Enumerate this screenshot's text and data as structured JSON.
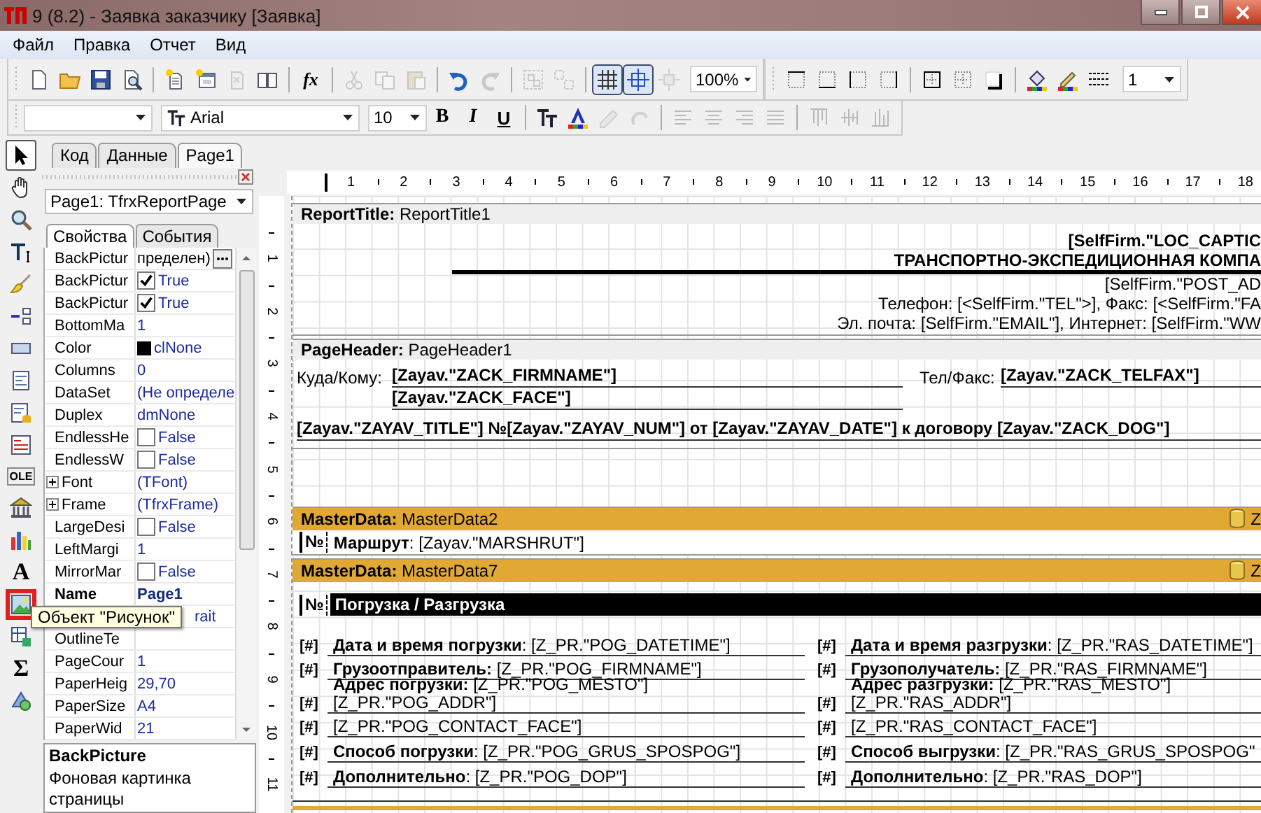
{
  "window": {
    "title": "9 (8.2) - Заявка заказчику [Заявка]"
  },
  "menu": [
    "Файл",
    "Правка",
    "Отчет",
    "Вид"
  ],
  "toolbar_main": [
    {
      "kind": "icon",
      "disabled": false,
      "pressed": false
    },
    {
      "kind": "icon",
      "disabled": false,
      "pressed": false
    },
    {
      "kind": "icon",
      "disabled": false,
      "pressed": false
    },
    {
      "kind": "icon",
      "disabled": false,
      "pressed": false
    },
    {
      "kind": "separator"
    },
    {
      "kind": "icon",
      "disabled": false,
      "pressed": false
    },
    {
      "kind": "icon",
      "disabled": false,
      "pressed": false
    },
    {
      "kind": "icon",
      "disabled": true,
      "pressed": false
    },
    {
      "kind": "icon",
      "disabled": false,
      "pressed": false
    },
    {
      "kind": "separator"
    },
    {
      "kind": "formula",
      "label": "fx",
      "disabled": false,
      "pressed": false
    },
    {
      "kind": "separator"
    },
    {
      "kind": "icon",
      "disabled": true,
      "pressed": false
    },
    {
      "kind": "icon",
      "disabled": true,
      "pressed": false
    },
    {
      "kind": "icon",
      "disabled": true,
      "pressed": false
    },
    {
      "kind": "separator"
    },
    {
      "kind": "icon",
      "disabled": false,
      "pressed": false
    },
    {
      "kind": "icon",
      "disabled": true,
      "pressed": false
    },
    {
      "kind": "separator"
    },
    {
      "kind": "icon",
      "disabled": true,
      "pressed": false
    },
    {
      "kind": "icon",
      "disabled": true,
      "pressed": false
    },
    {
      "kind": "separator"
    },
    {
      "kind": "icon",
      "disabled": false,
      "pressed": true
    },
    {
      "kind": "icon",
      "disabled": false,
      "pressed": true
    },
    {
      "kind": "icon",
      "disabled": true,
      "pressed": false
    },
    {
      "kind": "combo",
      "value": "100%"
    },
    {
      "kind": "break"
    },
    {
      "kind": "icon",
      "disabled": false,
      "pressed": false
    },
    {
      "kind": "icon",
      "disabled": false,
      "pressed": false
    },
    {
      "kind": "icon",
      "disabled": false,
      "pressed": false
    },
    {
      "kind": "icon",
      "disabled": false,
      "pressed": false
    },
    {
      "kind": "separator"
    },
    {
      "kind": "icon",
      "disabled": false,
      "pressed": false
    },
    {
      "kind": "icon",
      "disabled": false,
      "pressed": false
    },
    {
      "kind": "icon",
      "disabled": false,
      "pressed": false
    },
    {
      "kind": "separator"
    },
    {
      "kind": "icon",
      "disabled": false,
      "pressed": false
    },
    {
      "kind": "icon",
      "disabled": false,
      "pressed": false
    },
    {
      "kind": "icon",
      "disabled": false,
      "pressed": false
    },
    {
      "kind": "combo",
      "value": "1"
    }
  ],
  "toolbar_format": [
    {
      "kind": "combo"
    },
    {
      "kind": "font_combo",
      "value": "Arial"
    },
    {
      "kind": "combo",
      "value": "10"
    },
    {
      "kind": "bold",
      "label": "B",
      "disabled": false,
      "pressed": false
    },
    {
      "kind": "italic",
      "label": "I",
      "disabled": false,
      "pressed": false
    },
    {
      "kind": "underline",
      "label": "U",
      "disabled": false,
      "pressed": false
    },
    {
      "kind": "separator"
    },
    {
      "kind": "icon",
      "disabled": false,
      "pressed": false
    },
    {
      "kind": "icon",
      "disabled": false,
      "pressed": false
    },
    {
      "kind": "icon",
      "disabled": true,
      "pressed": false
    },
    {
      "kind": "icon",
      "disabled": true,
      "pressed": false
    },
    {
      "kind": "separator"
    },
    {
      "kind": "icon",
      "disabled": true,
      "pressed": false
    },
    {
      "kind": "icon",
      "disabled": true,
      "pressed": false
    },
    {
      "kind": "icon",
      "disabled": true,
      "pressed": false
    },
    {
      "kind": "icon",
      "disabled": true,
      "pressed": false
    },
    {
      "kind": "separator"
    },
    {
      "kind": "icon",
      "disabled": true,
      "pressed": false
    },
    {
      "kind": "icon",
      "disabled": true,
      "pressed": false
    },
    {
      "kind": "icon",
      "disabled": true,
      "pressed": false
    }
  ],
  "tools": [
    {
      "kind": "icon",
      "selected": true,
      "highlighted": false
    },
    {
      "kind": "icon",
      "selected": false,
      "highlighted": false
    },
    {
      "kind": "icon",
      "selected": false,
      "highlighted": false
    },
    {
      "kind": "icon",
      "selected": false,
      "highlighted": false
    },
    {
      "kind": "icon",
      "selected": false,
      "highlighted": false
    },
    {
      "kind": "icon",
      "selected": false,
      "highlighted": false
    },
    {
      "kind": "icon",
      "selected": false,
      "highlighted": false
    },
    {
      "kind": "icon",
      "selected": false,
      "highlighted": false
    },
    {
      "kind": "icon",
      "selected": false,
      "highlighted": false
    },
    {
      "kind": "icon",
      "selected": false,
      "highlighted": false
    },
    {
      "kind": "label",
      "label": "OLE",
      "selected": false,
      "highlighted": false
    },
    {
      "kind": "icon",
      "selected": false,
      "highlighted": false
    },
    {
      "kind": "icon",
      "selected": false,
      "highlighted": false
    },
    {
      "kind": "glyph",
      "label": "A",
      "selected": false,
      "highlighted": false
    },
    {
      "kind": "icon",
      "selected": false,
      "highlighted": true
    },
    {
      "kind": "icon",
      "selected": false,
      "highlighted": false
    },
    {
      "kind": "glyph",
      "label": "Σ",
      "selected": false,
      "highlighted": false
    },
    {
      "kind": "icon",
      "selected": false,
      "highlighted": false
    }
  ],
  "tooltip": "Объект \"Рисунок\"",
  "doc_tabs": [
    {
      "label": "Код",
      "selected": false
    },
    {
      "label": "Данные",
      "selected": false
    },
    {
      "label": "Page1",
      "selected": true
    }
  ],
  "inspector": {
    "object": "Page1: TfrxReportPage",
    "tabs": [
      {
        "label": "Свойства",
        "selected": true
      },
      {
        "label": "События",
        "selected": false
      }
    ],
    "properties": [
      {
        "kind": "button",
        "name": "BackPictur",
        "value": "пределен)"
      },
      {
        "kind": "check",
        "name": "BackPictur",
        "checked": true,
        "value": "True"
      },
      {
        "kind": "check",
        "name": "BackPictur",
        "checked": true,
        "value": "True"
      },
      {
        "kind": "text",
        "name": "BottomMa",
        "value": "1"
      },
      {
        "kind": "color",
        "name": "Color",
        "color": "#000000",
        "value": "clNone"
      },
      {
        "kind": "text",
        "name": "Columns",
        "value": "0"
      },
      {
        "kind": "text",
        "name": "DataSet",
        "value": "(Не определе"
      },
      {
        "kind": "text",
        "name": "Duplex",
        "value": "dmNone"
      },
      {
        "kind": "check",
        "name": "EndlessHe",
        "checked": false,
        "value": "False"
      },
      {
        "kind": "check",
        "name": "EndlessW",
        "checked": false,
        "value": "False"
      },
      {
        "kind": "expand",
        "name": "Font",
        "expanded": false,
        "value": "(TFont)"
      },
      {
        "kind": "expand",
        "name": "Frame",
        "expanded": false,
        "value": "(TfrxFrame)"
      },
      {
        "kind": "check",
        "name": "LargeDesi",
        "checked": false,
        "value": "False"
      },
      {
        "kind": "text",
        "name": "LeftMargi",
        "value": "1"
      },
      {
        "kind": "check",
        "name": "MirrorMar",
        "checked": false,
        "value": "False"
      },
      {
        "kind": "bold",
        "name": "Name",
        "value": "Page1"
      },
      {
        "kind": "covered",
        "value": "rait"
      },
      {
        "kind": "text",
        "name": "OutlineTe"
      },
      {
        "kind": "text",
        "name": "PageCour",
        "value": "1"
      },
      {
        "kind": "text",
        "name": "PaperHeig",
        "value": "29,70"
      },
      {
        "kind": "text",
        "name": "PaperSize",
        "value": "A4"
      },
      {
        "kind": "text",
        "name": "PaperWid",
        "value": "21"
      }
    ],
    "description": {
      "title": "BackPicture",
      "text": "Фоновая картинка страницы"
    }
  },
  "ruler": {
    "horizontal": [
      "1",
      "2",
      "3",
      "4",
      "5",
      "6",
      "7",
      "8",
      "9",
      "10",
      "11",
      "12",
      "13",
      "14",
      "15",
      "16",
      "17",
      "18"
    ],
    "vertical": [
      "1",
      "2",
      "3",
      "4",
      "5",
      "6",
      "7",
      "8",
      "9",
      "10",
      "11"
    ]
  },
  "bands": [
    {
      "kind": "title",
      "title": "**ReportTitle:** ReportTitle1",
      "color": "#eeeeee",
      "lines": [
        {
          "kind": "text",
          "text": "[SelfFirm.\"LOC_CAPTIC",
          "bold": true
        },
        {
          "kind": "text",
          "text": "ТРАНСПОРТНО-ЭКСПЕДИЦИОННАЯ КОМПА",
          "bold": true
        },
        {
          "kind": "rule"
        },
        {
          "kind": "text",
          "text": "[SelfFirm.\"POST_AD",
          "bold": false
        },
        {
          "kind": "text",
          "text": "Телефон: [<SelfFirm.\"TEL\">], Факс: [<SelfFirm.\"FA",
          "bold": false
        },
        {
          "kind": "text",
          "text": "Эл. почта: [SelfFirm.\"EMAIL\"], Интернет: [SelfFirm.\"WW",
          "bold": false
        }
      ]
    },
    {
      "kind": "header",
      "title": "**PageHeader:** PageHeader1",
      "color": "#eeeeee",
      "to_label": "Куда/Кому:",
      "firm": "[Zayav.\"ZACK_FIRMNAME\"]",
      "phone_label": "Тел/Факс:",
      "phone": "[Zayav.\"ZACK_TELFAX\"]",
      "face": "[Zayav.\"ZACK_FACE\"]",
      "heading": "[Zayav.\"ZAYAV_TITLE\"] №[Zayav.\"ZAYAV_NUM\"] от [Zayav.\"ZAYAV_DATE\"] к договору [Zayav.\"ZACK_DOG\"]"
    },
    {
      "kind": "route",
      "title": "**MasterData:** MasterData2",
      "color": "#e1a833",
      "source": "Z",
      "num": "№",
      "text": "**Маршрут**: [Zayav.\"MARSHRUT\"]"
    },
    {
      "kind": "points",
      "title": "**MasterData:** MasterData7",
      "color": "#e1a833",
      "source": "Z",
      "num": "№",
      "heading": "Погрузка / Разгрузка",
      "columns": [
        [
          {
            "mark": "[#]",
            "lines": [
              "**Дата и время погрузки**: [Z_PR.\"POG_DATETIME\"]"
            ]
          },
          {
            "mark": "[#]",
            "lines": [
              "**Грузоотправитель:** [Z_PR.\"POG_FIRMNAME\"]"
            ]
          },
          {
            "mark": "[#]",
            "lines": [
              "**Адрес погрузки:** [Z_PR.\"POG_MESTO\"]",
              "[Z_PR.\"POG_ADDR\"]"
            ]
          },
          {
            "mark": "[#]",
            "lines": [
              "[Z_PR.\"POG_CONTACT_FACE\"]"
            ]
          },
          {
            "mark": "[#]",
            "lines": [
              "**Способ погрузки**: [Z_PR.\"POG_GRUS_SPOSPOG\"]"
            ]
          },
          {
            "mark": "[#]",
            "lines": [
              "**Дополнительно**: [Z_PR.\"POG_DOP\"]"
            ]
          }
        ],
        [
          {
            "mark": "[#]",
            "lines": [
              "**Дата и время разгрузки**: [Z_PR.\"RAS_DATETIME\"]"
            ]
          },
          {
            "mark": "[#]",
            "lines": [
              "**Грузополучатель:** [Z_PR.\"RAS_FIRMNAME\"]"
            ]
          },
          {
            "mark": "[#]",
            "lines": [
              "**Адрес разгрузки:** [Z_PR.\"RAS_MESTO\"]",
              "[Z_PR.\"RAS_ADDR\"]"
            ]
          },
          {
            "mark": "[#]",
            "lines": [
              "[Z_PR.\"RAS_CONTACT_FACE\"]"
            ]
          },
          {
            "mark": "[#]",
            "lines": [
              "**Способ выгрузки**: [Z_PR.\"RAS_GRUS_SPOSPOG\""
            ]
          },
          {
            "mark": "[#]",
            "lines": [
              "**Дополнительно**: [Z_PR.\"RAS_DOP\"]"
            ]
          }
        ]
      ]
    },
    {
      "kind": "strip",
      "color": "#e1a833"
    }
  ]
}
